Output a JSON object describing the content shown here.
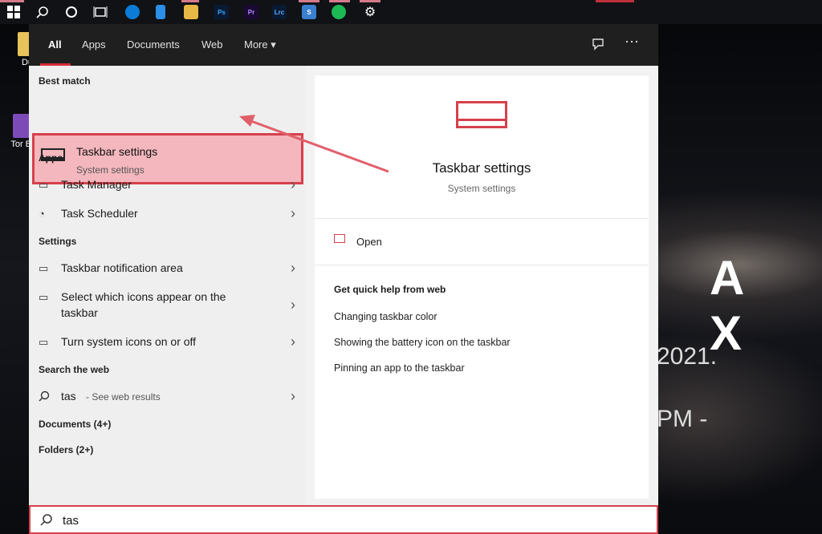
{
  "desktop": {
    "icons": [
      {
        "label": "Du"
      },
      {
        "label": "Tor Br"
      }
    ],
    "wallpaper_logo": "A X",
    "wallpaper_year": "2021.",
    "wallpaper_time": "PM -"
  },
  "taskbar": {
    "apps": [
      "Ps",
      "Pr",
      "Lrc",
      "S"
    ]
  },
  "tabs": {
    "items": [
      "All",
      "Apps",
      "Documents",
      "Web",
      "More ▾"
    ],
    "active": "All"
  },
  "best_match": {
    "header": "Best match",
    "title": "Taskbar settings",
    "subtitle": "System settings"
  },
  "apps_section": {
    "header": "Apps",
    "items": [
      {
        "label": "Task Manager"
      },
      {
        "label": "Task Scheduler"
      }
    ]
  },
  "settings_section": {
    "header": "Settings",
    "items": [
      {
        "label": "Taskbar notification area"
      },
      {
        "label": "Select which icons appear on the"
      },
      {
        "label": "taskbar"
      },
      {
        "label": "Turn system icons on or off"
      }
    ]
  },
  "web_section": {
    "header": "Search the web",
    "query": "tas",
    "hint": "- See web results"
  },
  "documents": "Documents (4+)",
  "folders": "Folders (2+)",
  "preview": {
    "title": "Taskbar settings",
    "subtitle": "System settings",
    "open_label": "Open",
    "quick_help_header": "Get quick help from web",
    "links": [
      "Changing taskbar color",
      "Showing the battery icon on the taskbar",
      "Pinning an app to the taskbar"
    ]
  },
  "search": {
    "value": "tas"
  },
  "colors": {
    "accent": "#d6404c",
    "highlight": "#f3b7bd"
  }
}
